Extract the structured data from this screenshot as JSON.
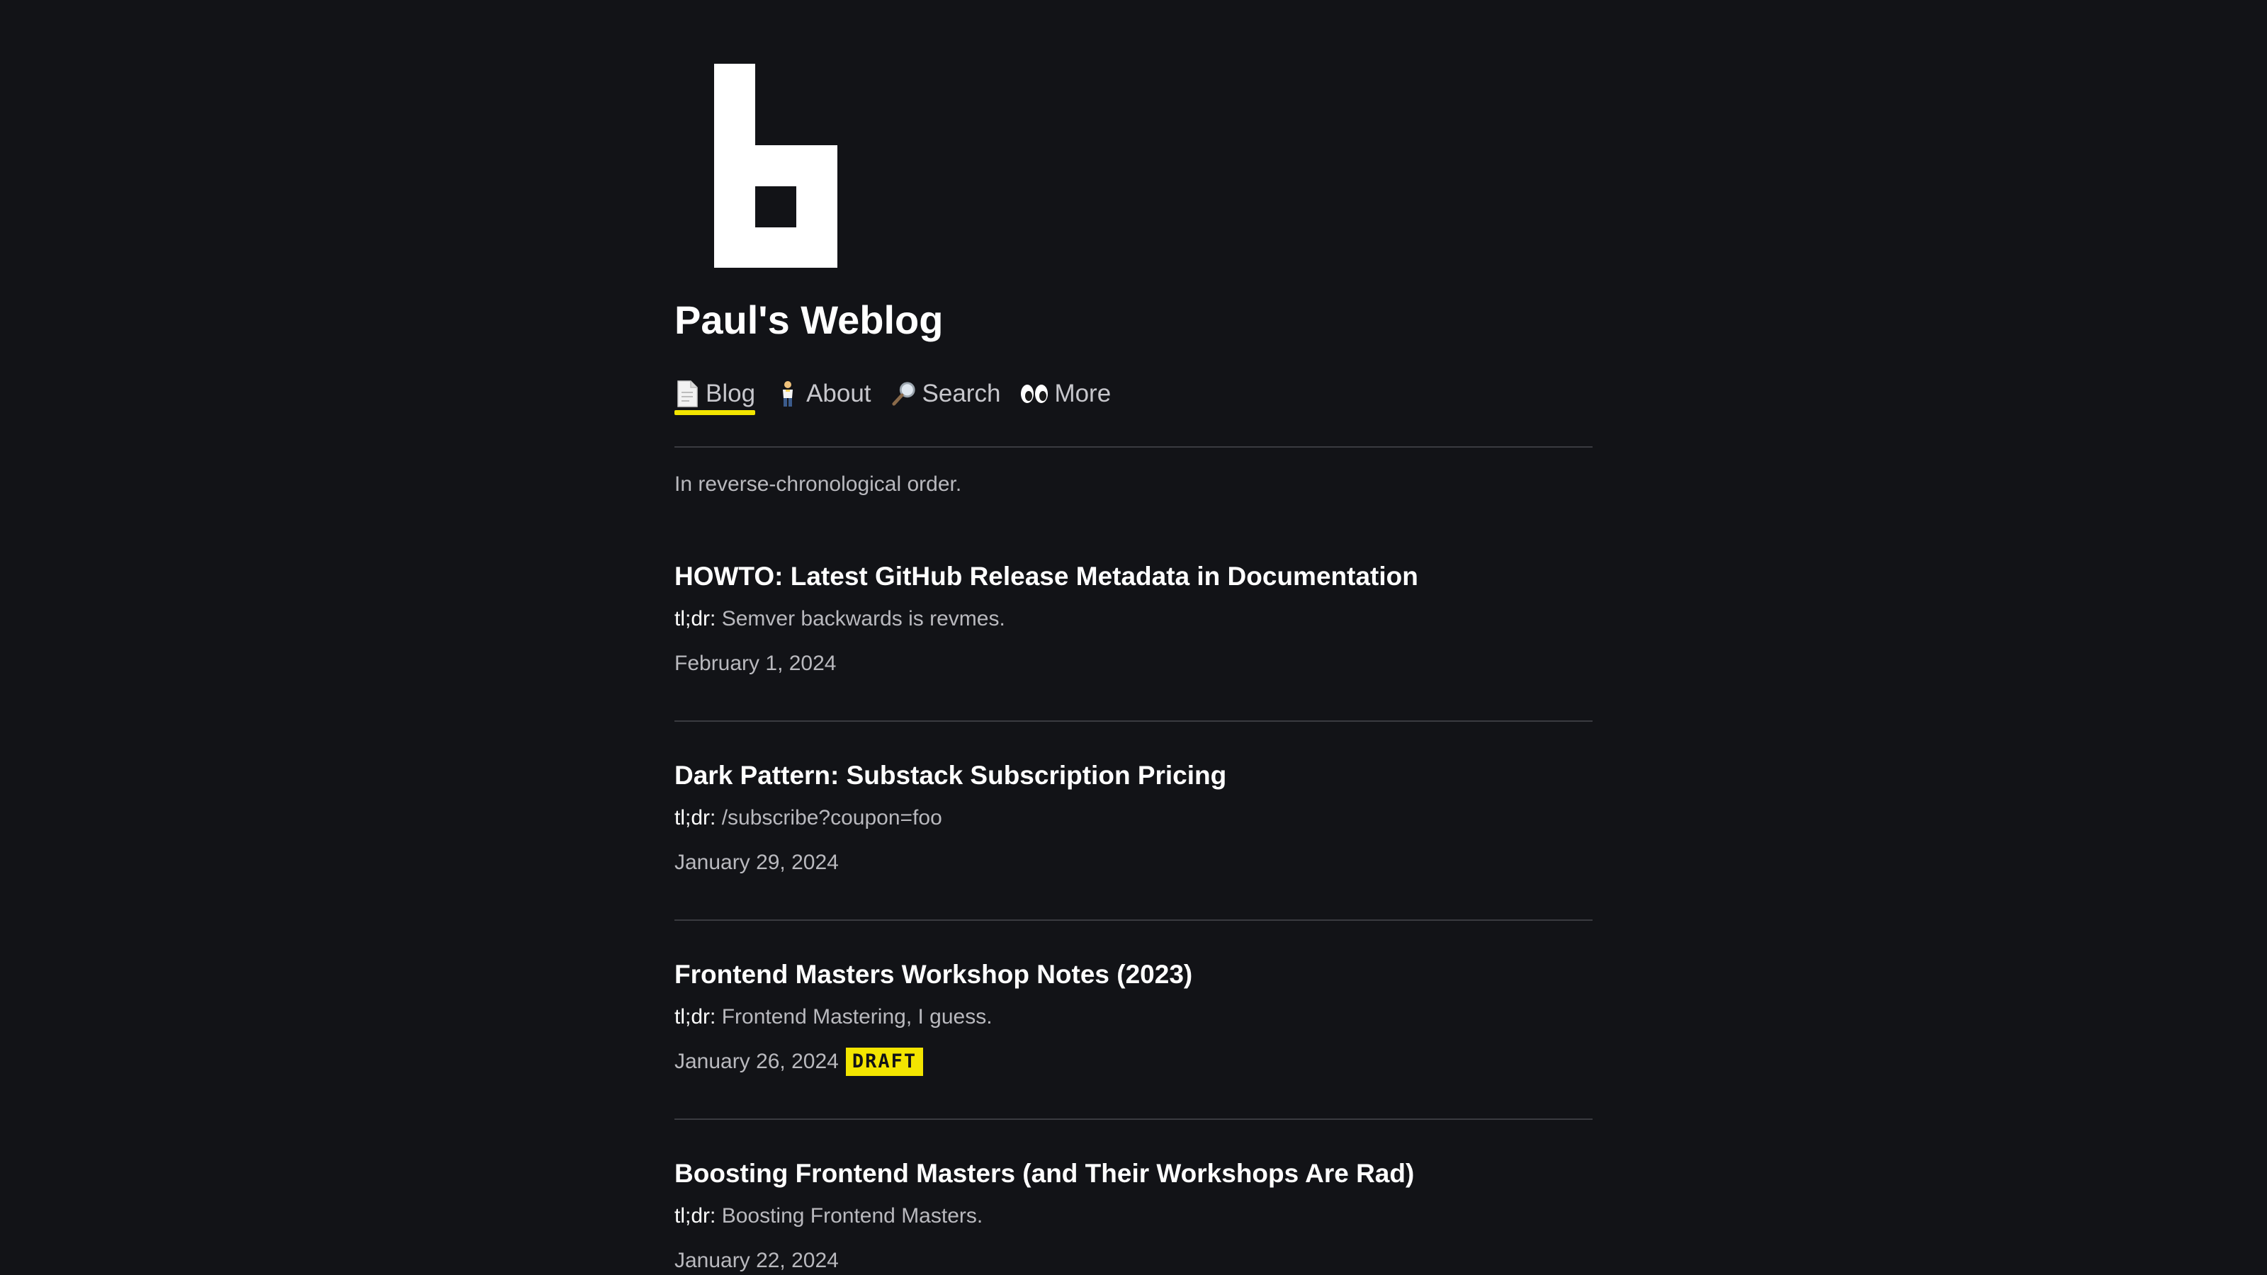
{
  "site": {
    "title": "Paul's Weblog",
    "logo": "pixel-b-logo"
  },
  "nav": {
    "items": [
      {
        "icon": "page-icon",
        "label": "Blog",
        "active": true
      },
      {
        "icon": "person-icon",
        "label": "About",
        "active": false
      },
      {
        "icon": "magnifier-icon",
        "label": "Search",
        "active": false
      },
      {
        "icon": "eyes-icon",
        "label": "More",
        "active": false
      }
    ]
  },
  "intro": "In reverse-chronological order.",
  "tldr_label": "tl;dr:",
  "posts": [
    {
      "title": "HOWTO: Latest GitHub Release Metadata in Documentation",
      "tldr": "Semver backwards is revmes.",
      "date": "February 1, 2024"
    },
    {
      "title": "Dark Pattern: Substack Subscription Pricing",
      "tldr": "/subscribe?coupon=foo",
      "date": "January 29, 2024"
    },
    {
      "title": "Frontend Masters Workshop Notes (2023)",
      "tldr": "Frontend Mastering, I guess.",
      "date": "January 26, 2024",
      "badge": "DRAFT"
    },
    {
      "title": "Boosting Frontend Masters (and Their Workshops Are Rad)",
      "tldr": "Boosting Frontend Masters.",
      "date": "January 22, 2024"
    }
  ],
  "colors": {
    "background": "#121317",
    "accent": "#f3e500",
    "text": "#ffffff",
    "muted": "#b9b9be"
  }
}
